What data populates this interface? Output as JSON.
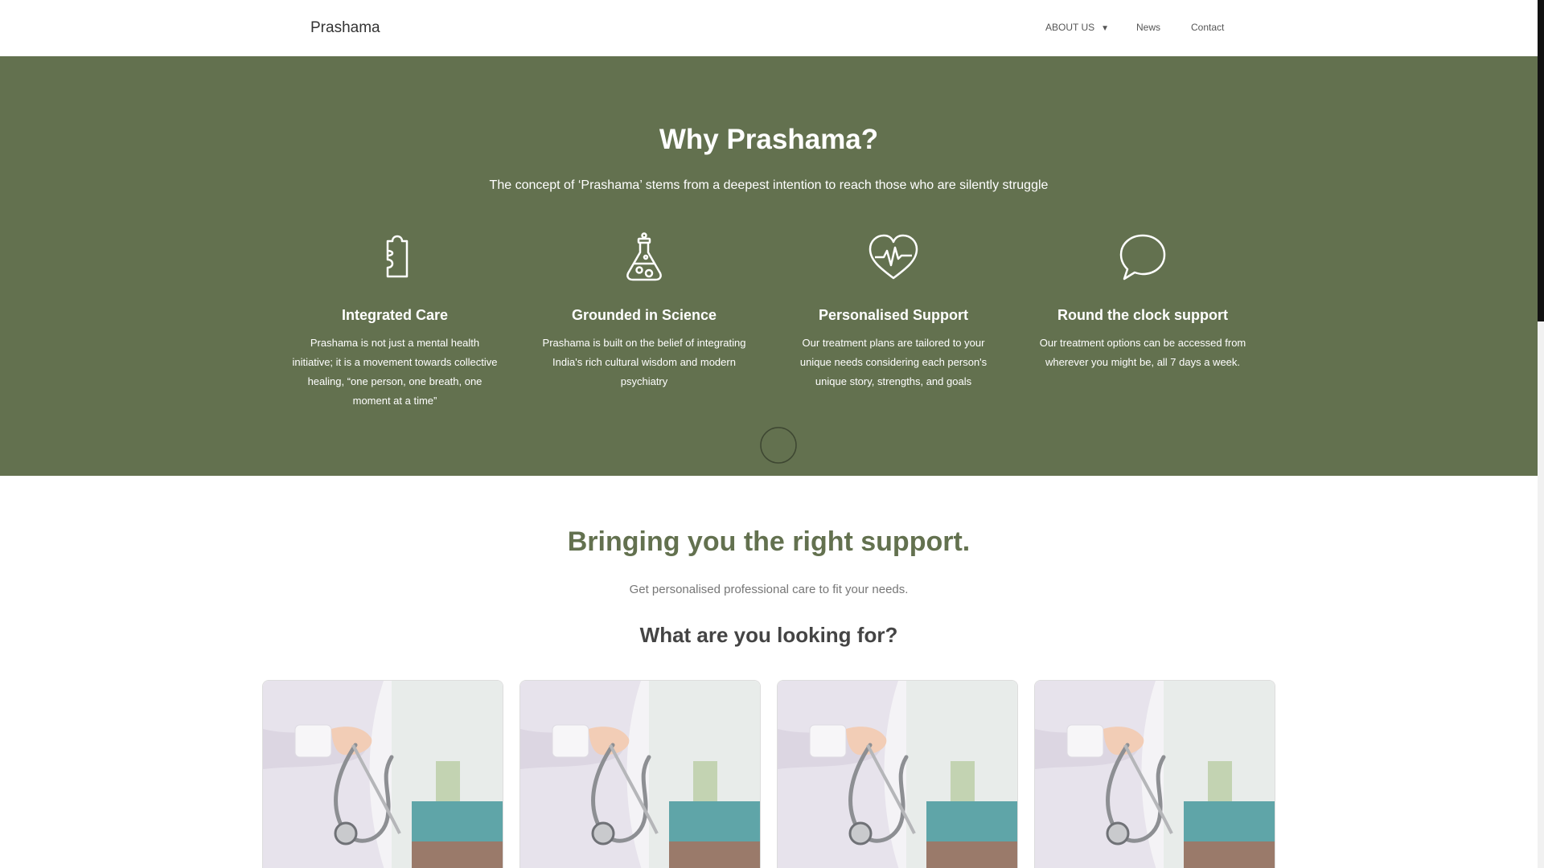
{
  "header": {
    "brand": "Prashama",
    "nav": {
      "about": "ABOUT US",
      "about_caret": "▼",
      "news": "News",
      "contact": "Contact"
    }
  },
  "why": {
    "title": "Why Prashama?",
    "subtitle": "The concept of ‘Prashama’ stems from a deepest intention to reach those who are silently struggle",
    "background_color": "#63714f",
    "features": [
      {
        "icon": "puzzle-icon",
        "title": "Integrated Care",
        "text": "Prashama is not just a mental health initiative; it is a movement towards collective healing, “one person, one breath, one moment at a time”"
      },
      {
        "icon": "flask-icon",
        "title": "Grounded in Science",
        "text": "Prashama is built on the belief of integrating India's rich cultural wisdom and modern psychiatry"
      },
      {
        "icon": "heartbeat-icon",
        "title": "Personalised Support",
        "text": "Our treatment plans are tailored to your unique needs considering each person's unique story, strengths, and goals"
      },
      {
        "icon": "chat-bubble-icon",
        "title": "Round the clock support",
        "text": "Our treatment options can be accessed from wherever you might be, all 7 days a week."
      }
    ]
  },
  "support": {
    "title": "Bringing you the right support.",
    "subtitle": "Get personalised professional care to fit your needs.",
    "question": "What are you looking for?",
    "accent_color": "#63714f"
  },
  "cards": [
    {
      "image": "doctor-stethoscope-image"
    },
    {
      "image": "doctor-stethoscope-image"
    },
    {
      "image": "doctor-stethoscope-image"
    },
    {
      "image": "doctor-stethoscope-image"
    }
  ]
}
